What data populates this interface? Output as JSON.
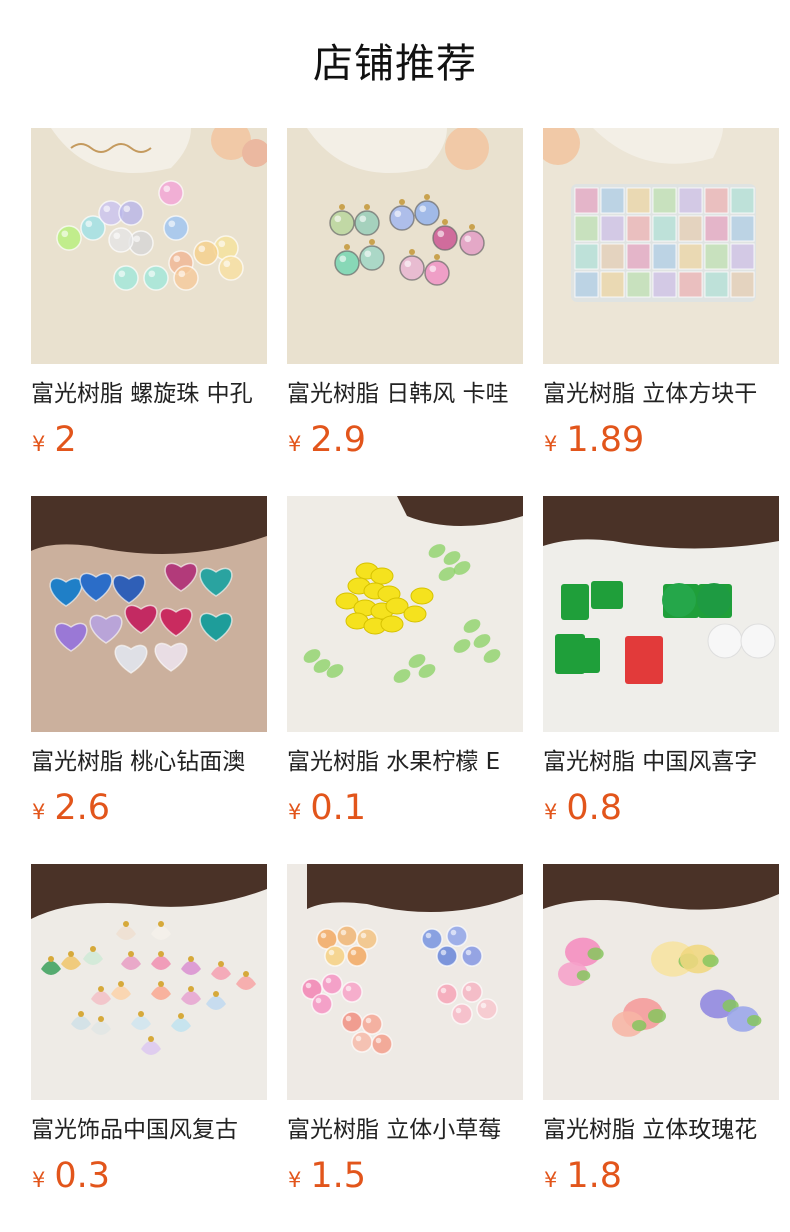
{
  "section": {
    "title": "店铺推荐"
  },
  "colors": {
    "price": "#e2551b",
    "text": "#222222"
  },
  "products": [
    {
      "name": "富光树脂 螺旋珠 中孔",
      "currency": "¥",
      "price": "2",
      "image": "spiral-beads-photo",
      "scene": "spiral"
    },
    {
      "name": "富光树脂 日韩风 卡哇",
      "currency": "¥",
      "price": "2.9",
      "image": "striped-pendant-beads-photo",
      "scene": "striped"
    },
    {
      "name": "富光树脂 立体方块干",
      "currency": "¥",
      "price": "1.89",
      "image": "dried-flower-cubes-photo",
      "scene": "cubes"
    },
    {
      "name": "富光树脂 桃心钻面澳",
      "currency": "¥",
      "price": "2.6",
      "image": "heart-gem-photo",
      "scene": "hearts"
    },
    {
      "name": "富光树脂 水果柠檬 E",
      "currency": "¥",
      "price": "0.1",
      "image": "lemon-leaf-beads-photo",
      "scene": "lemons"
    },
    {
      "name": "富光树脂 中国风喜字",
      "currency": "¥",
      "price": "0.8",
      "image": "double-happiness-charms-photo",
      "scene": "happiness"
    },
    {
      "name": "富光饰品中国风复古",
      "currency": "¥",
      "price": "0.3",
      "image": "flower-cap-pendants-photo",
      "scene": "caps"
    },
    {
      "name": "富光树脂 立体小草莓",
      "currency": "¥",
      "price": "1.5",
      "image": "strawberry-flower-beads-photo",
      "scene": "strawberry"
    },
    {
      "name": "富光树脂 立体玫瑰花",
      "currency": "¥",
      "price": "1.8",
      "image": "rose-bud-beads-photo",
      "scene": "roses"
    }
  ]
}
